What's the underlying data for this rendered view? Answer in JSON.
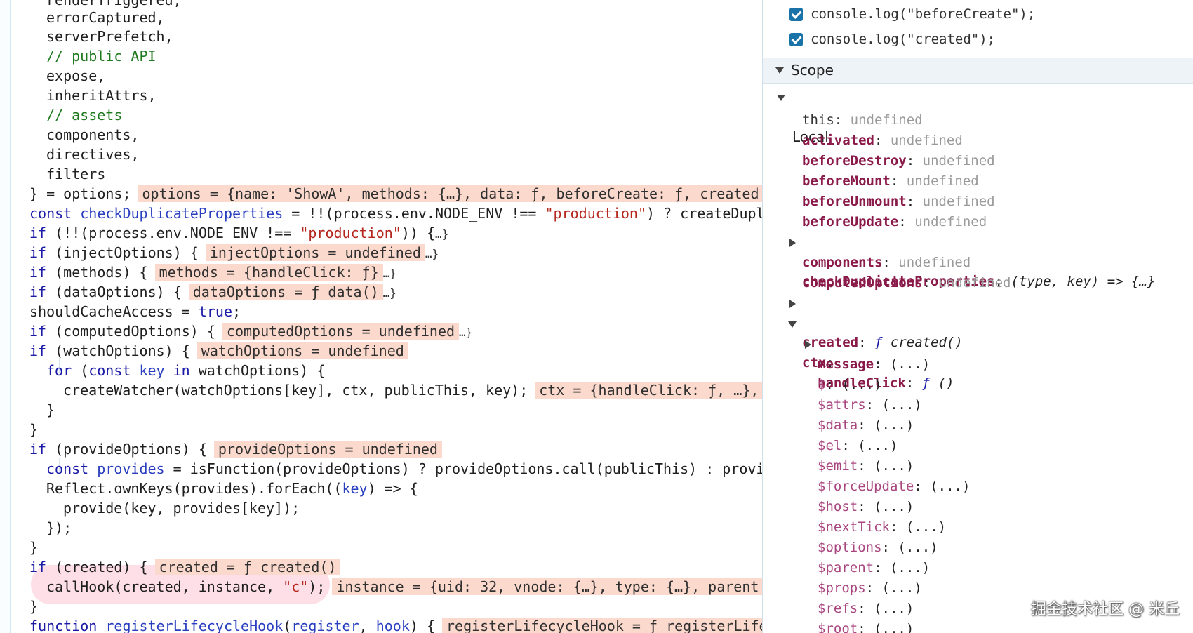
{
  "code": {
    "l0": "renderTriggered,",
    "l1": "errorCaptured,",
    "l2": "serverPrefetch,",
    "l3": "// public API",
    "l4": "expose,",
    "l5": "inheritAttrs,",
    "l6": "// assets",
    "l7": "components,",
    "l8": "directives,",
    "l9": "filters",
    "l10a": "} = options;",
    "l10chip": "options = {name: 'ShowA', methods: {…}, data: ƒ, beforeCreate: ƒ, created",
    "l11a": "const ",
    "l11b": "checkDuplicateProperties",
    "l11c": " = !!(process.env.NODE_ENV !== ",
    "l11d": "\"production\"",
    "l11e": ") ? createDupli",
    "l12a": "if",
    "l12b": " (!!(process.env.NODE_ENV !== ",
    "l12c": "\"production\"",
    "l12d": ")) {",
    "l12e": "…}",
    "l13a": "if",
    "l13b": " (injectOptions) {",
    "l13chip": "injectOptions = undefined",
    "l13e": "…}",
    "l14a": "if",
    "l14b": " (methods) {",
    "l14chip": "methods = {handleClick: ƒ}",
    "l14e": "…}",
    "l15a": "if",
    "l15b": " (dataOptions) {",
    "l15chip": "dataOptions = ƒ data()",
    "l15e": "…}",
    "l16a": "shouldCacheAccess = ",
    "l16b": "true",
    "l16c": ";",
    "l17a": "if",
    "l17b": " (computedOptions) {",
    "l17chip": "computedOptions = undefined",
    "l17e": "…}",
    "l18a": "if",
    "l18b": " (watchOptions) {",
    "l18chip": "watchOptions = undefined",
    "l19a": "for",
    "l19b": " (",
    "l19c": "const ",
    "l19d": "key",
    "l19e": " in",
    "l19f": " watchOptions) {",
    "l20a": "createWatcher(watchOptions[key], ctx, publicThis, key);",
    "l20chip": "ctx = {handleClick: ƒ, …},",
    "l21": "}",
    "l22": "}",
    "l23a": "if",
    "l23b": " (provideOptions) {",
    "l23chip": "provideOptions = undefined",
    "l24a": "const ",
    "l24b": "provides",
    "l24c": " = isFunction(provideOptions) ? provideOptions.call(publicThis) : provid",
    "l25a": "Reflect.ownKeys(provides).forEach((",
    "l25b": "key",
    "l25c": ") => {",
    "l26": "provide(key, provides[key]);",
    "l27": "});",
    "l28": "}",
    "l29a": "if",
    "l29b": " (created) {",
    "l29chip": "created = ƒ created()",
    "l30a": "callHook(created, instance, ",
    "l30b": "\"c\"",
    "l30c": ");",
    "l30chip": "instance = {uid: 32, vnode: {…}, type: {…}, parent",
    "l31": "}",
    "l32a": "function ",
    "l32b": "registerLifecycleHook",
    "l32c": "(",
    "l32d": "register",
    "l32e": ", ",
    "l32f": "hook",
    "l32g": ") {",
    "l32chip": "registerLifecycleHook = ƒ registerLife"
  },
  "breakpoints": [
    "console.log(\"beforeCreate\");",
    "console.log(\"created\");"
  ],
  "scope": {
    "title": "Scope",
    "local": "Local",
    "this_key": "this",
    "undefined": "undefined",
    "colon": ":",
    "ellipsis": "(...)",
    "keys": {
      "activated": "activated",
      "beforeDestroy": "beforeDestroy",
      "beforeMount": "beforeMount",
      "beforeUnmount": "beforeUnmount",
      "beforeUpdate": "beforeUpdate",
      "checkDuplicateProperties": "checkDuplicateProperties",
      "components": "components",
      "computedOptions": "computedOptions",
      "created": "created",
      "ctx": "ctx"
    },
    "values": {
      "checkDuplicateProperties": "(type, key) => {…}",
      "created_f": "ƒ",
      "created": " created()",
      "handleClick_f": "ƒ",
      "handleClick": " ()"
    },
    "ctx_children": {
      "handleClick": "handleClick",
      "message": "message",
      "dollar": "$",
      "attrs": "$attrs",
      "data": "$data",
      "el": "$el",
      "emit": "$emit",
      "forceUpdate": "$forceUpdate",
      "host": "$host",
      "nextTick": "$nextTick",
      "options": "$options",
      "parent": "$parent",
      "props": "$props",
      "refs": "$refs",
      "root": "$root"
    }
  },
  "watermark": "掘金技术社区 @ 米丘"
}
